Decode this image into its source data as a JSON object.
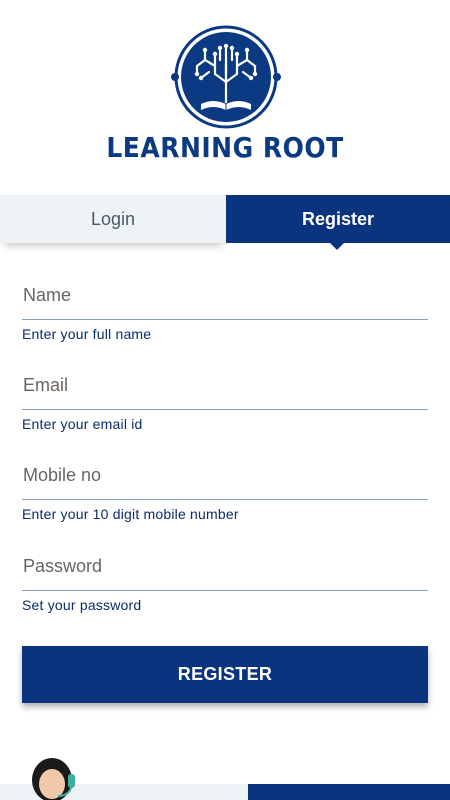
{
  "brand": {
    "name": "LEARNING ROOT",
    "logo_icon": "tree-book-logo-icon"
  },
  "tabs": {
    "login": "Login",
    "register": "Register",
    "active": "register"
  },
  "form": {
    "name": {
      "placeholder": "Name",
      "hint": "Enter your full name"
    },
    "email": {
      "placeholder": "Email",
      "hint": "Enter your email id"
    },
    "mobile": {
      "placeholder": "Mobile no",
      "hint": "Enter your 10 digit mobile number"
    },
    "password": {
      "placeholder": "Password",
      "hint": "Set your password"
    },
    "submit_label": "REGISTER"
  },
  "support": {
    "icon": "support-agent-avatar-icon"
  },
  "colors": {
    "primary": "#0b347f",
    "tab_inactive_bg": "#eef3f6",
    "hint_text": "#0b2b6b"
  }
}
